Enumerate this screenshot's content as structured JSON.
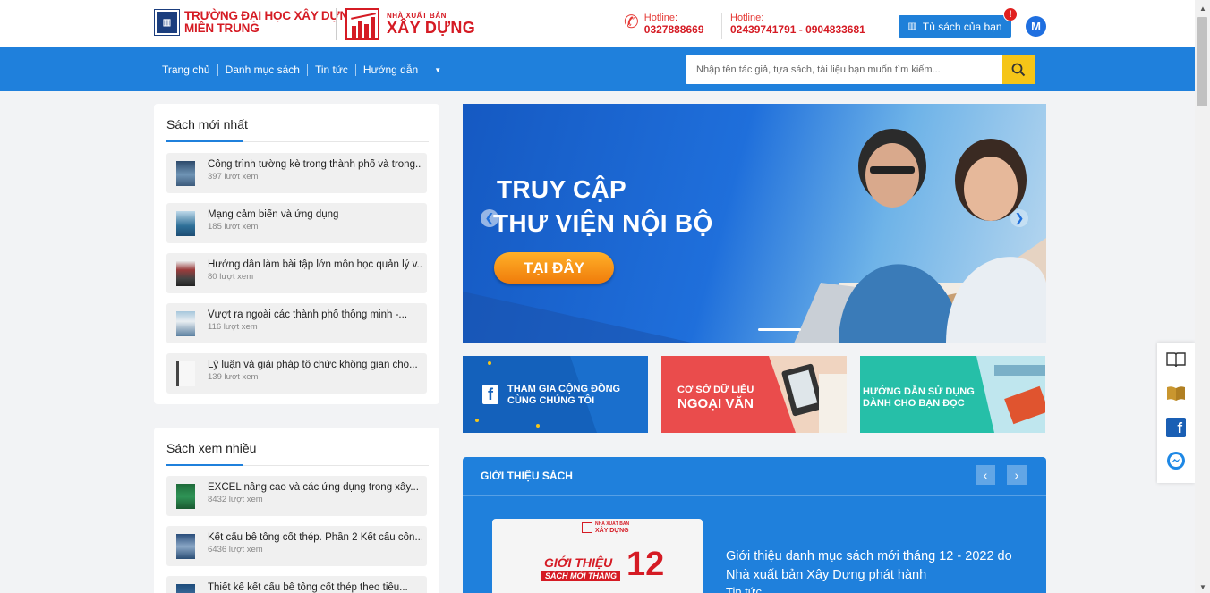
{
  "header": {
    "logo1_line1": "TRƯỜNG ĐẠI HỌC XÂY DỰNG",
    "logo1_line2": "MIỀN TRUNG",
    "logo2_small": "NHÀ XUẤT BẢN",
    "logo2_large": "XÂY DỰNG",
    "hotline1_label": "Hotline:",
    "hotline1_number": "0327888669",
    "hotline2_label": "Hotline:",
    "hotline2_number": "02439741791 - 0904833681",
    "shelf_label": "Tủ sách của bạn",
    "notification_badge": "!",
    "avatar_initial": "M"
  },
  "nav": {
    "items": [
      "Trang chủ",
      "Danh mục sách",
      "Tin tức",
      "Hướng dẫn"
    ]
  },
  "search": {
    "placeholder": "Nhập tên tác giả, tựa sách, tài liệu bạn muốn tìm kiếm..."
  },
  "newest": {
    "title": "Sách mới nhất",
    "books": [
      {
        "title": "Công trình tường kè trong thành phố và trong...",
        "views": "397 lượt xem"
      },
      {
        "title": "Mạng cảm biến và ứng dụng",
        "views": "185 lượt xem"
      },
      {
        "title": "Hướng dẫn làm bài tập lớn môn học quản lý v...",
        "views": "80 lượt xem"
      },
      {
        "title": "Vượt ra ngoài các thành phố thông minh -...",
        "views": "116 lượt xem"
      },
      {
        "title": "Lý luận và giải pháp tổ chức không gian cho...",
        "views": "139 lượt xem"
      }
    ]
  },
  "popular": {
    "title": "Sách xem nhiều",
    "books": [
      {
        "title": "EXCEL nâng cao và các ứng dụng trong xây...",
        "views": "8432 lượt xem"
      },
      {
        "title": "Kết cấu bê tông cốt thép. Phần 2 Kết cấu côn...",
        "views": "6436 lượt xem"
      },
      {
        "title": "Thiết kế kết cấu bê tông cốt thép theo tiêu...",
        "views": ""
      }
    ]
  },
  "banner": {
    "line1": "TRUY CẬP",
    "line2": "THƯ VIỆN NỘI BỘ",
    "cta": "TẠI ĐÂY"
  },
  "promos": [
    {
      "line1": "THAM GIA CỘNG ĐỒNG",
      "line2": "CÙNG CHÚNG TÔI",
      "color": "#1565c0"
    },
    {
      "line1": "CƠ SỞ DỮ LIỆU",
      "line2": "NGOẠI VĂN",
      "color": "#e94a4a"
    },
    {
      "line1": "HƯỚNG DẪN SỬ DỤNG",
      "line2": "DÀNH CHO BẠN ĐỌC",
      "color": "#26bfa8"
    }
  ],
  "intro": {
    "heading": "GIỚI THIỆU SÁCH",
    "thumb_publisher_small": "NHÀ XUẤT BẢN",
    "thumb_publisher_large": "XÂY DỰNG",
    "thumb_line1": "GIỚI THIỆU",
    "thumb_line2": "SÁCH MỚI THÁNG",
    "thumb_number": "12",
    "title": "Giới thiệu danh mục sách mới tháng 12 - 2022 do Nhà xuất bản Xây Dựng phát hành",
    "more": "Tin tức"
  },
  "colors": {
    "brand_blue": "#1f80dc",
    "brand_red": "#d51b24",
    "search_button": "#f5c518"
  }
}
